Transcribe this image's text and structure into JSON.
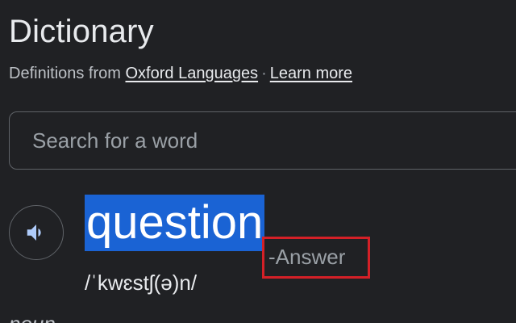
{
  "header": {
    "title": "Dictionary",
    "attribution_prefix": "Definitions from",
    "source_link": "Oxford Languages",
    "separator": "·",
    "learn_more_link": "Learn more"
  },
  "search": {
    "placeholder": "Search for a word",
    "value": ""
  },
  "entry": {
    "pronounce_icon": "speaker-icon",
    "word": "question",
    "word_highlight_color": "#1a63d4",
    "answer_annotation": "-Answer",
    "annotation_box_color": "#d42027",
    "phonetic": "/ˈkwɛstʃ(ə)n/",
    "part_of_speech": "noun"
  }
}
